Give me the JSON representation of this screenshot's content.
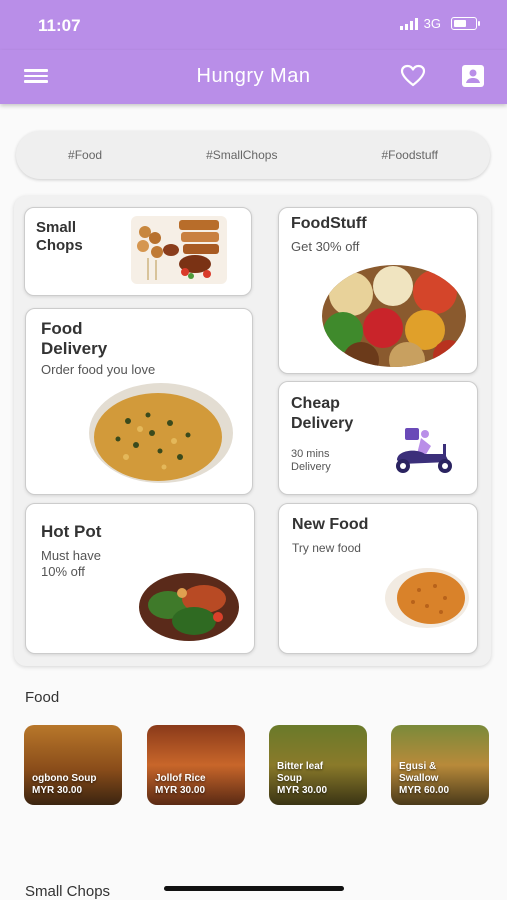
{
  "status": {
    "time": "11:07",
    "network": "3G"
  },
  "appbar": {
    "title": "Hungry Man"
  },
  "tags": [
    "#Food",
    "#SmallChops",
    "#Foodstuff"
  ],
  "cards": {
    "small_chops": {
      "title_l1": "Small",
      "title_l2": "Chops"
    },
    "foodstuff": {
      "title": "FoodStuff",
      "subtitle": "Get 30% off"
    },
    "food_delivery": {
      "title_l1": "Food",
      "title_l2": "Delivery",
      "subtitle": "Order food you love"
    },
    "cheap_delivery": {
      "title_l1": "Cheap",
      "title_l2": "Delivery",
      "sub_l1": "30 mins",
      "sub_l2": "Delivery"
    },
    "hot_pot": {
      "title": "Hot Pot",
      "sub_l1": "Must have",
      "sub_l2": "10% off"
    },
    "new_food": {
      "title": "New Food",
      "subtitle": "Try new food"
    }
  },
  "food_section": {
    "title": "Food"
  },
  "foods": [
    {
      "l1": "ogbono Soup",
      "l2": "MYR 30.00"
    },
    {
      "l1": "Jollof Rice",
      "l2": "MYR 30.00"
    },
    {
      "l1": "Bitter leaf",
      "l2": "Soup",
      "l3": "MYR 30.00"
    },
    {
      "l1": "Egusi &",
      "l2": "Swallow",
      "l3": "MYR 60.00"
    }
  ],
  "small_chops_section": {
    "title": "Small Chops"
  },
  "icons": {
    "menu": "menu-icon",
    "heart": "heart-icon",
    "profile": "profile-icon",
    "scooter": "delivery-scooter-icon"
  },
  "colors": {
    "primary": "#b98ee8",
    "background": "#fafafa"
  }
}
